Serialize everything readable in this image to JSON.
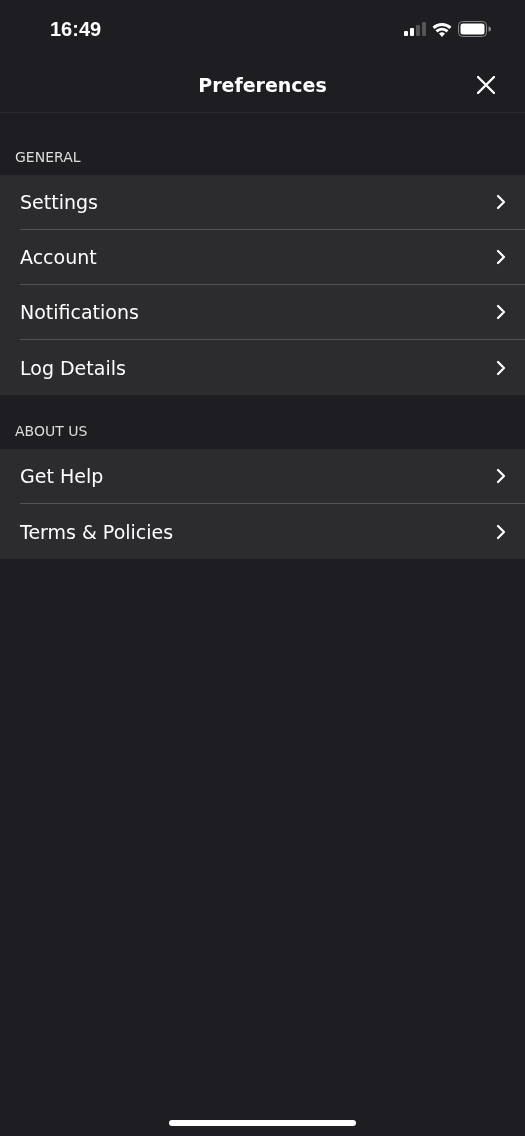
{
  "status_bar": {
    "time": "16:49"
  },
  "nav": {
    "title": "Preferences"
  },
  "sections": [
    {
      "header": "GENERAL",
      "items": [
        {
          "label": "Settings"
        },
        {
          "label": "Account"
        },
        {
          "label": "Notifications"
        },
        {
          "label": "Log Details"
        }
      ]
    },
    {
      "header": "ABOUT US",
      "items": [
        {
          "label": "Get Help"
        },
        {
          "label": "Terms & Policies"
        }
      ]
    }
  ]
}
